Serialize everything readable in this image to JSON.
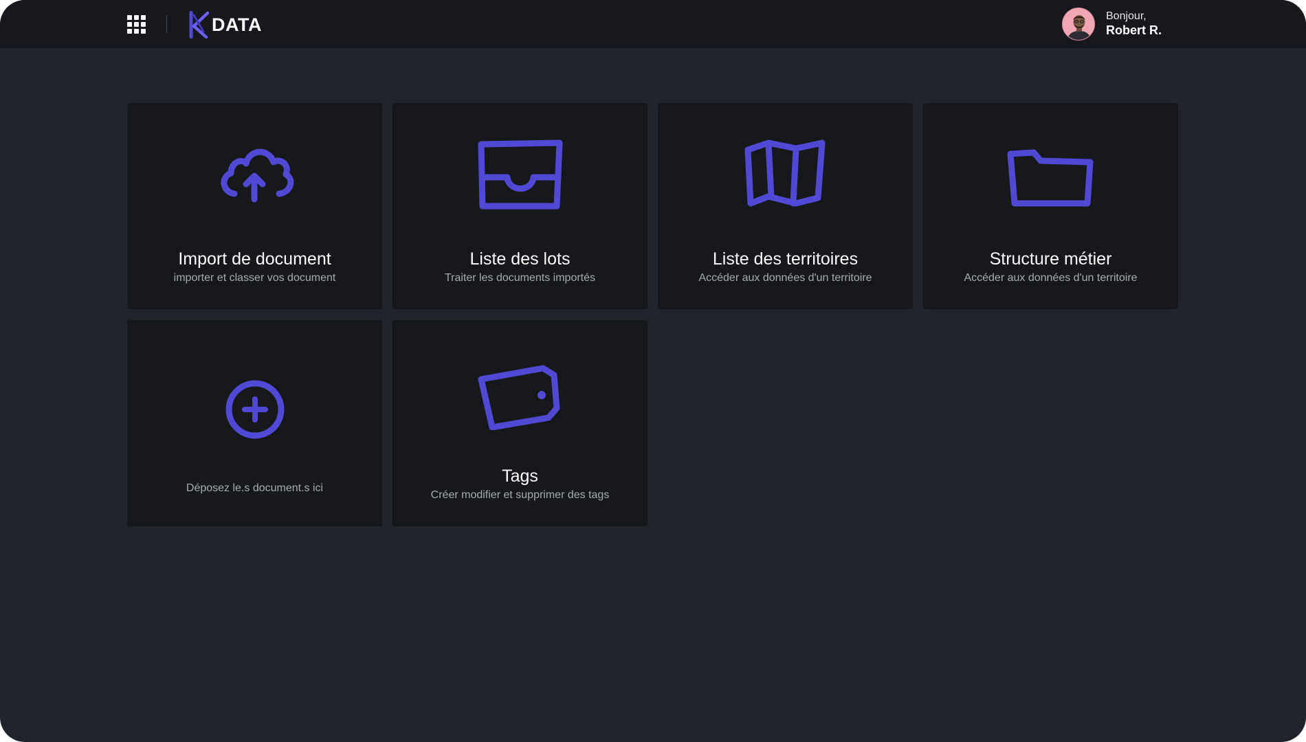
{
  "header": {
    "app_name": "DATA",
    "user": {
      "greeting": "Bonjour,",
      "name": "Robert R."
    }
  },
  "cards": [
    {
      "icon": "cloud-upload-icon",
      "title": "Import de document",
      "subtitle": "importer et classer vos document"
    },
    {
      "icon": "inbox-tray-icon",
      "title": "Liste des lots",
      "subtitle": "Traiter les documents importés"
    },
    {
      "icon": "map-icon",
      "title": "Liste des territoires",
      "subtitle": "Accéder aux données d'un territoire"
    },
    {
      "icon": "folder-icon",
      "title": "Structure métier",
      "subtitle": "Accéder aux données d'un territoire"
    },
    {
      "icon": "plus-circle-icon",
      "title": "",
      "subtitle": "Déposez le.s document.s ici"
    },
    {
      "icon": "tag-icon",
      "title": "Tags",
      "subtitle": "Créer modifier et supprimer des tags"
    }
  ],
  "colors": {
    "accent": "#5149d3",
    "background": "#20242b",
    "topbar": "#16181d",
    "card": "#17181c"
  }
}
